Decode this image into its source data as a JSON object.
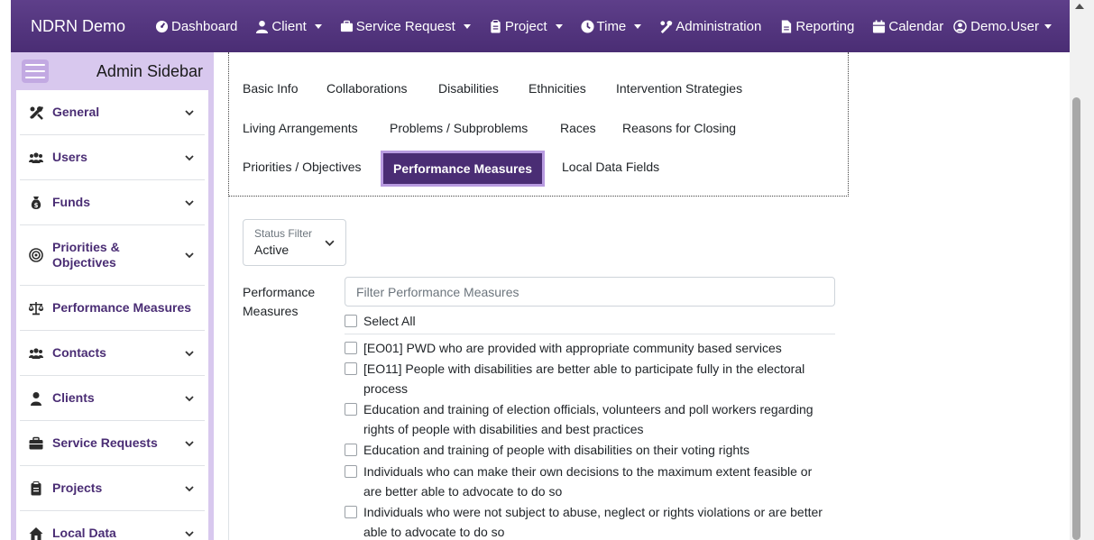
{
  "navbar": {
    "brand": "NDRN Demo",
    "items": [
      {
        "label": "Dashboard",
        "icon": "dashboard-icon",
        "dropdown": false
      },
      {
        "label": "Client",
        "icon": "user-icon",
        "dropdown": true
      },
      {
        "label": "Service Request",
        "icon": "briefcase-icon",
        "dropdown": true
      },
      {
        "label": "Project",
        "icon": "clipboard-icon",
        "dropdown": true
      },
      {
        "label": "Time",
        "icon": "clock-icon",
        "dropdown": true
      },
      {
        "label": "Administration",
        "icon": "tools-icon",
        "dropdown": false
      },
      {
        "label": "Reporting",
        "icon": "file-icon",
        "dropdown": false
      },
      {
        "label": "Calendar",
        "icon": "calendar-icon",
        "dropdown": false
      }
    ],
    "user": "Demo.User"
  },
  "sidebar": {
    "title": "Admin Sidebar",
    "items": [
      {
        "label": "General",
        "icon": "tools-icon",
        "expandable": true
      },
      {
        "label": "Users",
        "icon": "users-icon",
        "expandable": true
      },
      {
        "label": "Funds",
        "icon": "money-bag-icon",
        "expandable": true
      },
      {
        "label": "Priorities & Objectives",
        "icon": "target-icon",
        "expandable": true
      },
      {
        "label": "Performance Measures",
        "icon": "balance-scale-icon",
        "expandable": false
      },
      {
        "label": "Contacts",
        "icon": "users-icon",
        "expandable": true
      },
      {
        "label": "Clients",
        "icon": "user-icon",
        "expandable": true
      },
      {
        "label": "Service Requests",
        "icon": "briefcase-icon",
        "expandable": true
      },
      {
        "label": "Projects",
        "icon": "clipboard-icon",
        "expandable": true
      },
      {
        "label": "Local Data",
        "icon": "home-icon",
        "expandable": true
      }
    ]
  },
  "tabs": [
    "Basic Info",
    "Collaborations",
    "Disabilities",
    "Ethnicities",
    "Intervention Strategies",
    "Living Arrangements",
    "Problems / Subproblems",
    "Races",
    "Reasons for Closing",
    "Priorities / Objectives",
    "Performance Measures",
    "Local Data Fields"
  ],
  "active_tab": "Performance Measures",
  "content": {
    "status_filter": {
      "label": "Status Filter",
      "value": "Active"
    },
    "pm_label": "Performance Measures",
    "filter_placeholder": "Filter Performance Measures",
    "select_all": "Select All",
    "measures": [
      "[EO01] PWD who are provided with appropriate community based services",
      "[EO11] People with disabilities are better able to participate fully in the electoral process",
      "Education and training of election officials, volunteers and poll workers regarding rights of people with disabilities and best practices",
      "Education and training of people with disabilities on their voting rights",
      "Individuals who can make their own decisions to the maximum extent feasible or are better able to advocate to do so",
      "Individuals who were not subject to abuse, neglect or rights violations or are better able to advocate to do so"
    ]
  },
  "colors": {
    "brand": "#4a2d74",
    "sidebar_bg": "#d8c8ee",
    "active_tab_border": "#b89be0"
  }
}
